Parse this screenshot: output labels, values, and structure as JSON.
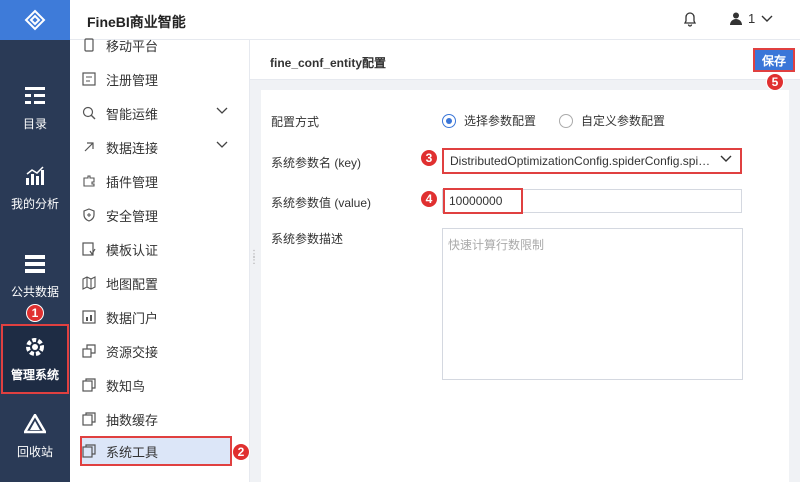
{
  "header": {
    "brand": "FineBI商业智能",
    "user_label": "1"
  },
  "rail": {
    "items": [
      {
        "label": "目录",
        "icon": "catalog-icon"
      },
      {
        "label": "我的分析",
        "icon": "analysis-icon"
      },
      {
        "label": "公共数据",
        "icon": "public-data-icon"
      },
      {
        "label": "管理系统",
        "icon": "gear-icon"
      },
      {
        "label": "回收站",
        "icon": "recycle-bin-icon"
      }
    ]
  },
  "submenu": {
    "items": [
      {
        "label": "移动平台"
      },
      {
        "label": "注册管理"
      },
      {
        "label": "智能运维"
      },
      {
        "label": "数据连接"
      },
      {
        "label": "插件管理"
      },
      {
        "label": "安全管理"
      },
      {
        "label": "模板认证"
      },
      {
        "label": "地图配置"
      },
      {
        "label": "数据门户"
      },
      {
        "label": "资源交接"
      },
      {
        "label": "数知鸟"
      },
      {
        "label": "抽数缓存"
      },
      {
        "label": "系统工具"
      }
    ]
  },
  "content": {
    "title": "fine_conf_entity配置",
    "save_label": "保存",
    "config_mode_label": "配置方式",
    "radio_select": "选择参数配置",
    "radio_custom": "自定义参数配置",
    "key_label": "系统参数名 (key)",
    "key_value": "DistributedOptimizationConfig.spiderConfig.spi…",
    "value_label": "系统参数值 (value)",
    "value_value": "10000000",
    "desc_label": "系统参数描述",
    "desc_placeholder": "快速计算行数限制"
  },
  "badges": {
    "b1": "1",
    "b2": "2",
    "b3": "3",
    "b4": "4",
    "b5": "5"
  },
  "colors": {
    "accent": "#3a76d8",
    "rail": "#2a3a56",
    "highlight": "#e04040"
  }
}
